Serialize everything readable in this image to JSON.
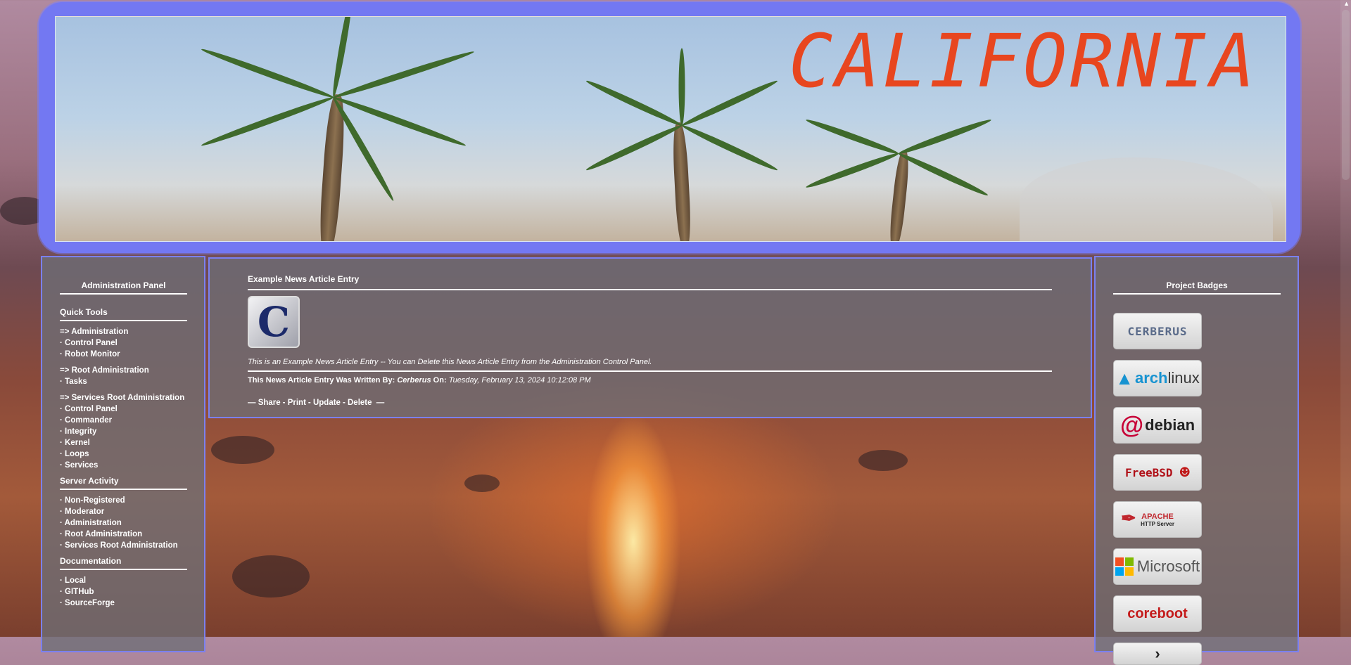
{
  "banner": {
    "title": "CALIFORNIA"
  },
  "left_panel": {
    "header": "Administration Panel",
    "sections": [
      {
        "title": "Quick Tools",
        "groups": [
          [
            "=> Administration",
            "· Control Panel",
            "· Robot Monitor"
          ],
          [
            "=> Root Administration",
            "· Tasks"
          ],
          [
            "=> Services Root Administration",
            "· Control Panel",
            "· Commander",
            "· Integrity",
            "· Kernel",
            "· Loops",
            "· Services"
          ]
        ]
      },
      {
        "title": "Server Activity",
        "groups": [
          [
            "· Non-Registered",
            "· Moderator",
            "· Administration",
            "· Root Administration",
            "· Services Root Administration"
          ]
        ]
      },
      {
        "title": "Documentation",
        "groups": [
          [
            "· Local",
            "· GITHub",
            "· SourceForge"
          ]
        ]
      }
    ]
  },
  "article": {
    "title": "Example News Article Entry",
    "logo_letter": "C",
    "description": "This is an Example News Article Entry -- You can Delete this News Article Entry from the Administration Control Panel.",
    "byline_prefix": "This News Article Entry Was Written By:",
    "author": "Cerberus",
    "on_label": "On:",
    "date": "Tuesday, February 13, 2024 10:12:08 PM",
    "actions": {
      "lead": "—",
      "share": "Share",
      "print": "Print",
      "update": "Update",
      "delete": "Delete",
      "separator": "-",
      "trail": "—"
    }
  },
  "right_panel": {
    "header": "Project Badges",
    "badges": {
      "cerberus": "CERBERUS",
      "arch_a": "arch",
      "arch_b": "linux",
      "debian": "debian",
      "freebsd": "FreeBSD",
      "apache_a": "APACHE",
      "apache_b": "HTTP Server",
      "microsoft": "Microsoft",
      "coreboot": "coreboot"
    }
  },
  "colors": {
    "frame": "#7378f2",
    "title_red": "#e8461f",
    "panel_border": "#7b80f0"
  }
}
